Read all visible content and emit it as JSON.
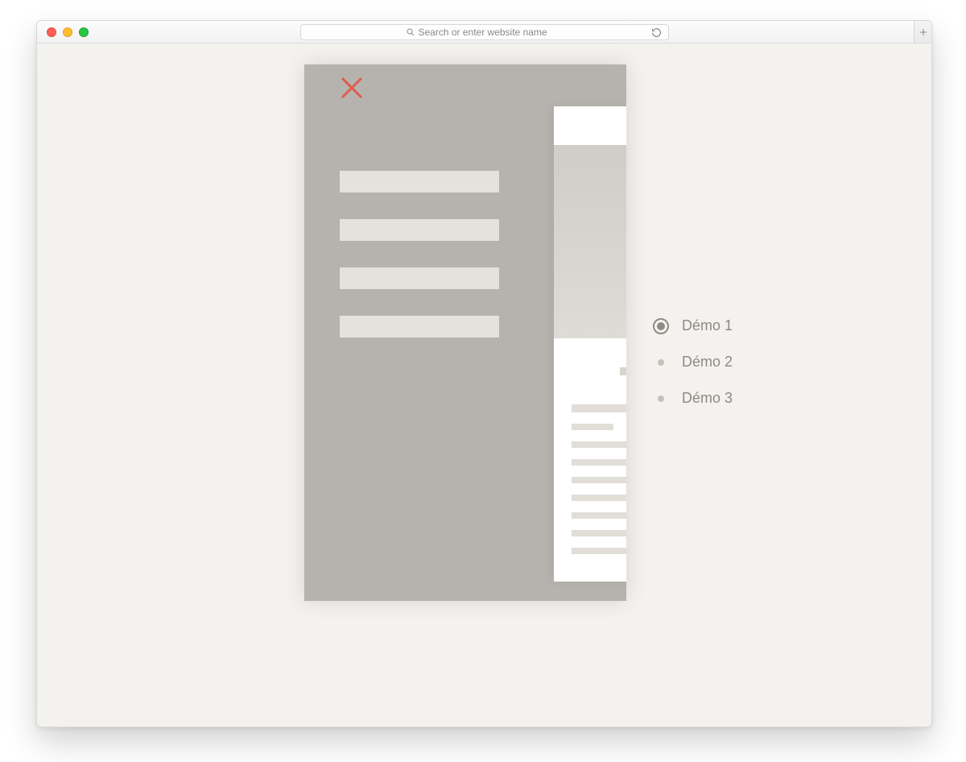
{
  "browser": {
    "address_placeholder": "Search or enter website name"
  },
  "demo_selector": {
    "items": [
      {
        "label": "Démo 1",
        "active": true
      },
      {
        "label": "Démo 2",
        "active": false
      },
      {
        "label": "Démo 3",
        "active": false
      }
    ]
  }
}
